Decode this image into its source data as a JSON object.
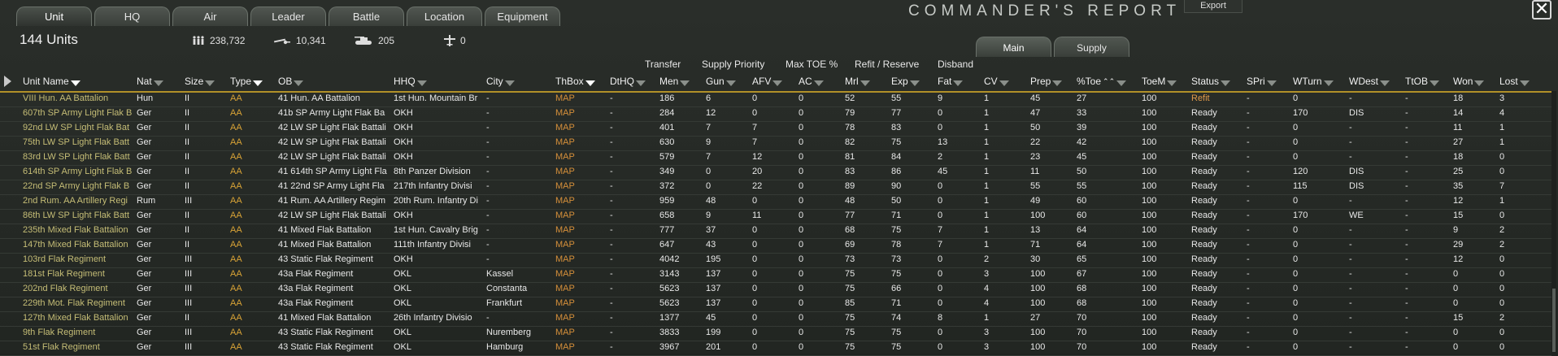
{
  "tabs": [
    "Unit",
    "HQ",
    "Air",
    "Leader",
    "Battle",
    "Location",
    "Equipment"
  ],
  "title": "COMMANDER'S REPORT",
  "export_label": "Export",
  "close_glyph": "✕",
  "units_count": "144 Units",
  "stats": {
    "men": "238,732",
    "guns": "10,341",
    "afv": "205",
    "aircraft": "0"
  },
  "subtabs": [
    "Main",
    "Supply"
  ],
  "group_headers": [
    "Transfer",
    "Supply Priority",
    "Max TOE %",
    "Refit / Reserve",
    "Disband"
  ],
  "columns": [
    "Unit Name",
    "Nat",
    "Size",
    "Type",
    "OB",
    "HHQ",
    "City",
    "ThBox",
    "DtHQ",
    "Men",
    "Gun",
    "AFV",
    "AC",
    "Mrl",
    "Exp",
    "Fat",
    "CV",
    "Prep",
    "%Toe",
    "ToeM",
    "Status",
    "SPri",
    "WTurn",
    "WDest",
    "TtOB",
    "Won",
    "Lost"
  ],
  "rows": [
    [
      "VIII Hun. AA Battalion",
      "Hun",
      "II",
      "AA",
      "41 Hun. AA Battalion",
      "1st Hun. Mountain Br",
      "-",
      "MAP",
      "-",
      "186",
      "6",
      "0",
      "0",
      "52",
      "55",
      "9",
      "1",
      "45",
      "27",
      "100",
      "Refit",
      "-",
      "0",
      "-",
      "-",
      "18",
      "3"
    ],
    [
      "607th SP Army Light Flak B",
      "Ger",
      "II",
      "AA",
      "41b SP Army Light Flak Ba",
      "OKH",
      "-",
      "MAP",
      "-",
      "284",
      "12",
      "0",
      "0",
      "79",
      "77",
      "0",
      "1",
      "47",
      "33",
      "100",
      "Ready",
      "-",
      "170",
      "DIS",
      "-",
      "14",
      "4"
    ],
    [
      "92nd LW SP Light Flak Bat",
      "Ger",
      "II",
      "AA",
      "42 LW SP Light Flak Battali",
      "OKH",
      "-",
      "MAP",
      "-",
      "401",
      "7",
      "7",
      "0",
      "78",
      "83",
      "0",
      "1",
      "50",
      "39",
      "100",
      "Ready",
      "-",
      "0",
      "-",
      "-",
      "11",
      "1"
    ],
    [
      "75th LW SP Light Flak Batt",
      "Ger",
      "II",
      "AA",
      "42 LW SP Light Flak Battali",
      "OKH",
      "-",
      "MAP",
      "-",
      "630",
      "9",
      "7",
      "0",
      "82",
      "75",
      "13",
      "1",
      "22",
      "42",
      "100",
      "Ready",
      "-",
      "0",
      "-",
      "-",
      "27",
      "1"
    ],
    [
      "83rd LW SP Light Flak Batt",
      "Ger",
      "II",
      "AA",
      "42 LW SP Light Flak Battali",
      "OKH",
      "-",
      "MAP",
      "-",
      "579",
      "7",
      "12",
      "0",
      "81",
      "84",
      "2",
      "1",
      "23",
      "45",
      "100",
      "Ready",
      "-",
      "0",
      "-",
      "-",
      "18",
      "0"
    ],
    [
      "614th SP Army Light Flak B",
      "Ger",
      "II",
      "AA",
      "41 614th SP Army Light Fla",
      "8th Panzer Division",
      "-",
      "MAP",
      "-",
      "349",
      "0",
      "20",
      "0",
      "83",
      "86",
      "45",
      "1",
      "11",
      "50",
      "100",
      "Ready",
      "-",
      "120",
      "DIS",
      "-",
      "25",
      "0"
    ],
    [
      "22nd SP Army Light Flak B",
      "Ger",
      "II",
      "AA",
      "41 22nd SP Army Light Fla",
      "217th Infantry Divisi",
      "-",
      "MAP",
      "-",
      "372",
      "0",
      "22",
      "0",
      "89",
      "90",
      "0",
      "1",
      "55",
      "55",
      "100",
      "Ready",
      "-",
      "115",
      "DIS",
      "-",
      "35",
      "7"
    ],
    [
      "2nd Rum. AA Artillery Regi",
      "Rum",
      "III",
      "AA",
      "41 Rum. AA Artillery Regim",
      "20th Rum. Infantry Di",
      "-",
      "MAP",
      "-",
      "959",
      "48",
      "0",
      "0",
      "48",
      "50",
      "0",
      "1",
      "49",
      "60",
      "100",
      "Ready",
      "-",
      "0",
      "-",
      "-",
      "12",
      "1"
    ],
    [
      "86th LW SP Light Flak Batt",
      "Ger",
      "II",
      "AA",
      "42 LW SP Light Flak Battali",
      "OKH",
      "-",
      "MAP",
      "-",
      "658",
      "9",
      "11",
      "0",
      "77",
      "71",
      "0",
      "1",
      "100",
      "60",
      "100",
      "Ready",
      "-",
      "170",
      "WE",
      "-",
      "15",
      "0"
    ],
    [
      "235th Mixed Flak Battalion",
      "Ger",
      "II",
      "AA",
      "41 Mixed Flak Battalion",
      "1st Hun. Cavalry Brig",
      "-",
      "MAP",
      "-",
      "777",
      "37",
      "0",
      "0",
      "68",
      "75",
      "7",
      "1",
      "13",
      "64",
      "100",
      "Ready",
      "-",
      "0",
      "-",
      "-",
      "9",
      "2"
    ],
    [
      "147th Mixed Flak Battalion",
      "Ger",
      "II",
      "AA",
      "41 Mixed Flak Battalion",
      "111th Infantry Divisi",
      "-",
      "MAP",
      "-",
      "647",
      "43",
      "0",
      "0",
      "69",
      "78",
      "7",
      "1",
      "71",
      "64",
      "100",
      "Ready",
      "-",
      "0",
      "-",
      "-",
      "29",
      "2"
    ],
    [
      "103rd Flak Regiment",
      "Ger",
      "III",
      "AA",
      "43 Static Flak Regiment",
      "OKH",
      "-",
      "MAP",
      "-",
      "4042",
      "195",
      "0",
      "0",
      "73",
      "73",
      "0",
      "2",
      "30",
      "65",
      "100",
      "Ready",
      "-",
      "0",
      "-",
      "-",
      "12",
      "0"
    ],
    [
      "181st Flak Regiment",
      "Ger",
      "III",
      "AA",
      "43a Flak Regiment",
      "OKL",
      "Kassel",
      "MAP",
      "-",
      "3143",
      "137",
      "0",
      "0",
      "75",
      "75",
      "0",
      "3",
      "100",
      "67",
      "100",
      "Ready",
      "-",
      "0",
      "-",
      "-",
      "0",
      "0"
    ],
    [
      "202nd Flak Regiment",
      "Ger",
      "III",
      "AA",
      "43a Flak Regiment",
      "OKL",
      "Constanta",
      "MAP",
      "-",
      "5623",
      "137",
      "0",
      "0",
      "75",
      "66",
      "0",
      "4",
      "100",
      "68",
      "100",
      "Ready",
      "-",
      "0",
      "-",
      "-",
      "0",
      "0"
    ],
    [
      "229th Mot. Flak Regiment",
      "Ger",
      "III",
      "AA",
      "43a Flak Regiment",
      "OKL",
      "Frankfurt",
      "MAP",
      "-",
      "5623",
      "137",
      "0",
      "0",
      "85",
      "71",
      "0",
      "4",
      "100",
      "68",
      "100",
      "Ready",
      "-",
      "0",
      "-",
      "-",
      "0",
      "0"
    ],
    [
      "127th Mixed Flak Battalion",
      "Ger",
      "II",
      "AA",
      "41 Mixed Flak Battalion",
      "26th Infantry Divisio",
      "-",
      "MAP",
      "-",
      "1377",
      "45",
      "0",
      "0",
      "75",
      "74",
      "8",
      "1",
      "27",
      "70",
      "100",
      "Ready",
      "-",
      "0",
      "-",
      "-",
      "15",
      "2"
    ],
    [
      "9th Flak Regiment",
      "Ger",
      "III",
      "AA",
      "43 Static Flak Regiment",
      "OKL",
      "Nuremberg",
      "MAP",
      "-",
      "3833",
      "199",
      "0",
      "0",
      "75",
      "75",
      "0",
      "3",
      "100",
      "70",
      "100",
      "Ready",
      "-",
      "0",
      "-",
      "-",
      "0",
      "0"
    ],
    [
      "51st Flak Regiment",
      "Ger",
      "III",
      "AA",
      "43 Static Flak Regiment",
      "OKL",
      "Hamburg",
      "MAP",
      "-",
      "3967",
      "201",
      "0",
      "0",
      "75",
      "75",
      "0",
      "3",
      "100",
      "70",
      "100",
      "Ready",
      "-",
      "0",
      "-",
      "-",
      "0",
      "0"
    ]
  ]
}
